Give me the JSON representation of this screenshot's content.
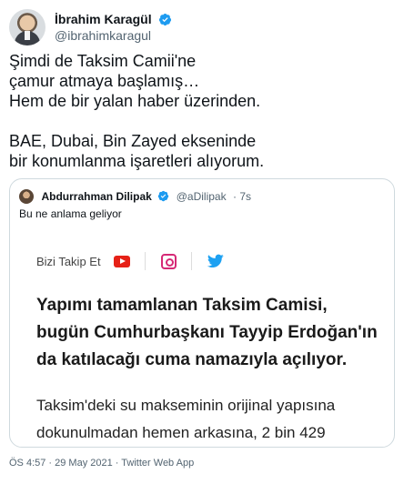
{
  "author": {
    "display_name": "İbrahim Karagül",
    "handle": "@ibrahimkaragul",
    "verified": true
  },
  "tweet": {
    "text": "Şimdi de Taksim Camii'ne\nçamur atmaya başlamış…\nHem de bir yalan haber üzerinden.\n\nBAE, Dubai, Bin Zayed ekseninde\nbir konumlanma işaretleri alıyorum."
  },
  "quoted_tweet": {
    "author_name": "Abdurrahman Dilipak",
    "handle": "@aDilipak",
    "time_ago": "· 7s",
    "text": "Bu ne anlama geliyor",
    "image": {
      "follow_label": "Bizi Takip Et",
      "icons": [
        "youtube-icon",
        "instagram-icon",
        "twitter-icon"
      ],
      "headline": "Yapımı tamamlanan Taksim Camisi,\nbugün Cumhurbaşkanı Tayyip Erdoğan'ın\nda katılacağı cuma namazıyla açılıyor.",
      "body": "Taksim'deki su makseminin orijinal yapısına\ndokunulmadan hemen arkasına, 2 bin 429"
    }
  },
  "footer": {
    "timestamp": "ÖS 4:57 · 29 May 2021 · Twitter Web App"
  },
  "colors": {
    "verified": "#1d9bf0",
    "youtube": "#e62117",
    "instagram": "#d62976",
    "twitter": "#1da1f2"
  }
}
